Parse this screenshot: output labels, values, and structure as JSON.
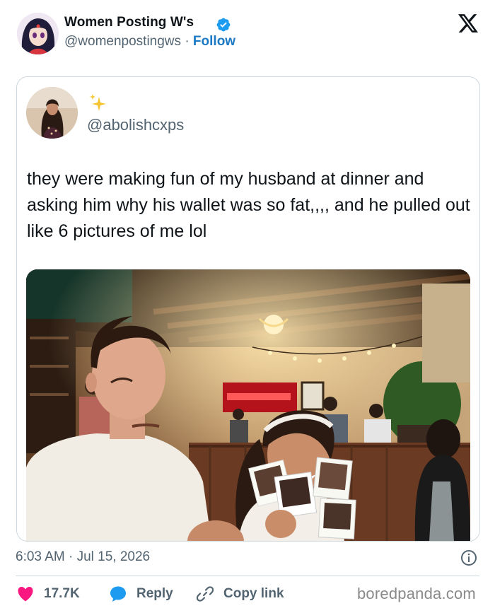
{
  "author": {
    "name": "Women Posting W's",
    "handle": "@womenpostingws",
    "separator": "·",
    "follow_label": "Follow",
    "verified": true
  },
  "quoted_tweet": {
    "handle": "@abolishcxps",
    "text": "they were making fun of my husband at dinner and asking him why his wallet was so fat,,,, and he pulled out like 6 pictures of me lol",
    "photo_alt": "Couple at a restaurant table, woman laughing while holding several instant photos"
  },
  "meta": {
    "timestamp": "6:03 AM · Jul 15, 2026"
  },
  "actions": {
    "likes_count": "17.7K",
    "reply_label": "Reply",
    "copy_label": "Copy link"
  },
  "watermark": "boredpanda.com",
  "colors": {
    "like": "#f91880",
    "reply": "#1d9bf0",
    "follow": "#1d79c3",
    "verified": "#1d9bf0"
  },
  "icons": {
    "like": "heart-icon",
    "reply": "speech-bubble-icon",
    "copy": "link-icon",
    "info": "info-icon",
    "brand": "x-logo-icon"
  }
}
